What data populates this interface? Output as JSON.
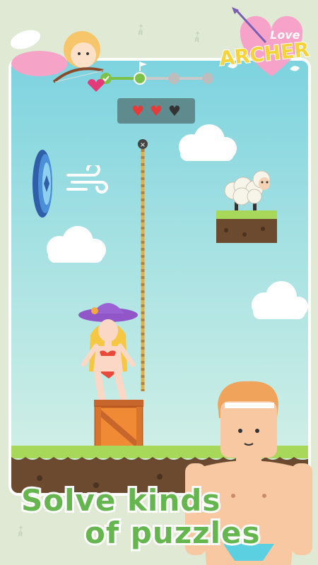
{
  "app": {
    "logo_line1": "Love",
    "logo_line2": "ARCHER"
  },
  "level_progress": {
    "stages": [
      "completed",
      "current",
      "locked",
      "locked"
    ],
    "current_stage": 2
  },
  "lives": {
    "total": 3,
    "remaining": 2
  },
  "caption": {
    "line1": "Solve kinds",
    "line2": "of puzzles"
  },
  "colors": {
    "sky_top": "#7dd3df",
    "grass": "#a7d85a",
    "dirt": "#6b4a2f",
    "caption_green": "#66b64f",
    "heart_full": "#e53a3a",
    "heart_empty": "#333333"
  },
  "icons": {
    "portal": "blue-portal-icon",
    "wind": "wind-icon",
    "flag": "flag-icon"
  }
}
